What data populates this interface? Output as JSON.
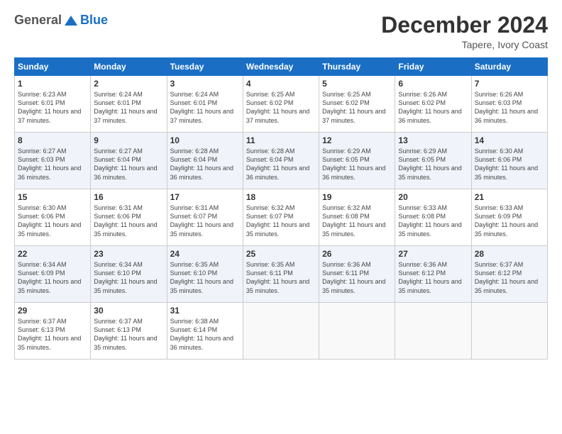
{
  "header": {
    "logo_general": "General",
    "logo_blue": "Blue",
    "month_title": "December 2024",
    "location": "Tapere, Ivory Coast"
  },
  "calendar": {
    "days_of_week": [
      "Sunday",
      "Monday",
      "Tuesday",
      "Wednesday",
      "Thursday",
      "Friday",
      "Saturday"
    ],
    "weeks": [
      [
        {
          "day": "1",
          "sunrise": "6:23 AM",
          "sunset": "6:01 PM",
          "daylight": "11 hours and 37 minutes."
        },
        {
          "day": "2",
          "sunrise": "6:24 AM",
          "sunset": "6:01 PM",
          "daylight": "11 hours and 37 minutes."
        },
        {
          "day": "3",
          "sunrise": "6:24 AM",
          "sunset": "6:01 PM",
          "daylight": "11 hours and 37 minutes."
        },
        {
          "day": "4",
          "sunrise": "6:25 AM",
          "sunset": "6:02 PM",
          "daylight": "11 hours and 37 minutes."
        },
        {
          "day": "5",
          "sunrise": "6:25 AM",
          "sunset": "6:02 PM",
          "daylight": "11 hours and 37 minutes."
        },
        {
          "day": "6",
          "sunrise": "6:26 AM",
          "sunset": "6:02 PM",
          "daylight": "11 hours and 36 minutes."
        },
        {
          "day": "7",
          "sunrise": "6:26 AM",
          "sunset": "6:03 PM",
          "daylight": "11 hours and 36 minutes."
        }
      ],
      [
        {
          "day": "8",
          "sunrise": "6:27 AM",
          "sunset": "6:03 PM",
          "daylight": "11 hours and 36 minutes."
        },
        {
          "day": "9",
          "sunrise": "6:27 AM",
          "sunset": "6:04 PM",
          "daylight": "11 hours and 36 minutes."
        },
        {
          "day": "10",
          "sunrise": "6:28 AM",
          "sunset": "6:04 PM",
          "daylight": "11 hours and 36 minutes."
        },
        {
          "day": "11",
          "sunrise": "6:28 AM",
          "sunset": "6:04 PM",
          "daylight": "11 hours and 36 minutes."
        },
        {
          "day": "12",
          "sunrise": "6:29 AM",
          "sunset": "6:05 PM",
          "daylight": "11 hours and 36 minutes."
        },
        {
          "day": "13",
          "sunrise": "6:29 AM",
          "sunset": "6:05 PM",
          "daylight": "11 hours and 35 minutes."
        },
        {
          "day": "14",
          "sunrise": "6:30 AM",
          "sunset": "6:06 PM",
          "daylight": "11 hours and 35 minutes."
        }
      ],
      [
        {
          "day": "15",
          "sunrise": "6:30 AM",
          "sunset": "6:06 PM",
          "daylight": "11 hours and 35 minutes."
        },
        {
          "day": "16",
          "sunrise": "6:31 AM",
          "sunset": "6:06 PM",
          "daylight": "11 hours and 35 minutes."
        },
        {
          "day": "17",
          "sunrise": "6:31 AM",
          "sunset": "6:07 PM",
          "daylight": "11 hours and 35 minutes."
        },
        {
          "day": "18",
          "sunrise": "6:32 AM",
          "sunset": "6:07 PM",
          "daylight": "11 hours and 35 minutes."
        },
        {
          "day": "19",
          "sunrise": "6:32 AM",
          "sunset": "6:08 PM",
          "daylight": "11 hours and 35 minutes."
        },
        {
          "day": "20",
          "sunrise": "6:33 AM",
          "sunset": "6:08 PM",
          "daylight": "11 hours and 35 minutes."
        },
        {
          "day": "21",
          "sunrise": "6:33 AM",
          "sunset": "6:09 PM",
          "daylight": "11 hours and 35 minutes."
        }
      ],
      [
        {
          "day": "22",
          "sunrise": "6:34 AM",
          "sunset": "6:09 PM",
          "daylight": "11 hours and 35 minutes."
        },
        {
          "day": "23",
          "sunrise": "6:34 AM",
          "sunset": "6:10 PM",
          "daylight": "11 hours and 35 minutes."
        },
        {
          "day": "24",
          "sunrise": "6:35 AM",
          "sunset": "6:10 PM",
          "daylight": "11 hours and 35 minutes."
        },
        {
          "day": "25",
          "sunrise": "6:35 AM",
          "sunset": "6:11 PM",
          "daylight": "11 hours and 35 minutes."
        },
        {
          "day": "26",
          "sunrise": "6:36 AM",
          "sunset": "6:11 PM",
          "daylight": "11 hours and 35 minutes."
        },
        {
          "day": "27",
          "sunrise": "6:36 AM",
          "sunset": "6:12 PM",
          "daylight": "11 hours and 35 minutes."
        },
        {
          "day": "28",
          "sunrise": "6:37 AM",
          "sunset": "6:12 PM",
          "daylight": "11 hours and 35 minutes."
        }
      ],
      [
        {
          "day": "29",
          "sunrise": "6:37 AM",
          "sunset": "6:13 PM",
          "daylight": "11 hours and 35 minutes."
        },
        {
          "day": "30",
          "sunrise": "6:37 AM",
          "sunset": "6:13 PM",
          "daylight": "11 hours and 35 minutes."
        },
        {
          "day": "31",
          "sunrise": "6:38 AM",
          "sunset": "6:14 PM",
          "daylight": "11 hours and 36 minutes."
        },
        null,
        null,
        null,
        null
      ]
    ]
  }
}
